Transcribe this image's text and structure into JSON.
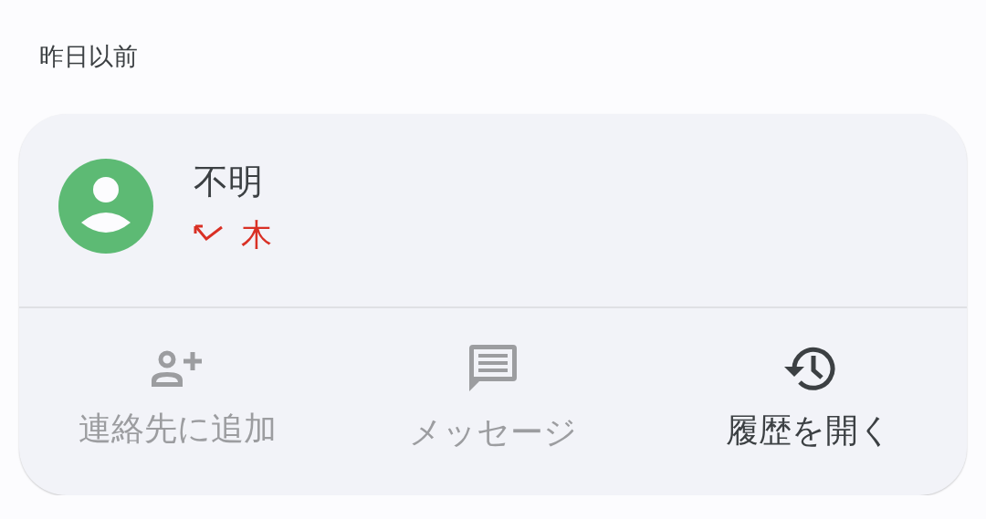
{
  "section_header": "昨日以前",
  "call": {
    "name": "不明",
    "missed": true,
    "day": "木"
  },
  "actions": [
    {
      "kind": "add_contact",
      "label": "連絡先に追加",
      "disabled": true
    },
    {
      "kind": "message",
      "label": "メッセージ",
      "disabled": true
    },
    {
      "kind": "history",
      "label": "履歴を開く",
      "disabled": false
    }
  ]
}
